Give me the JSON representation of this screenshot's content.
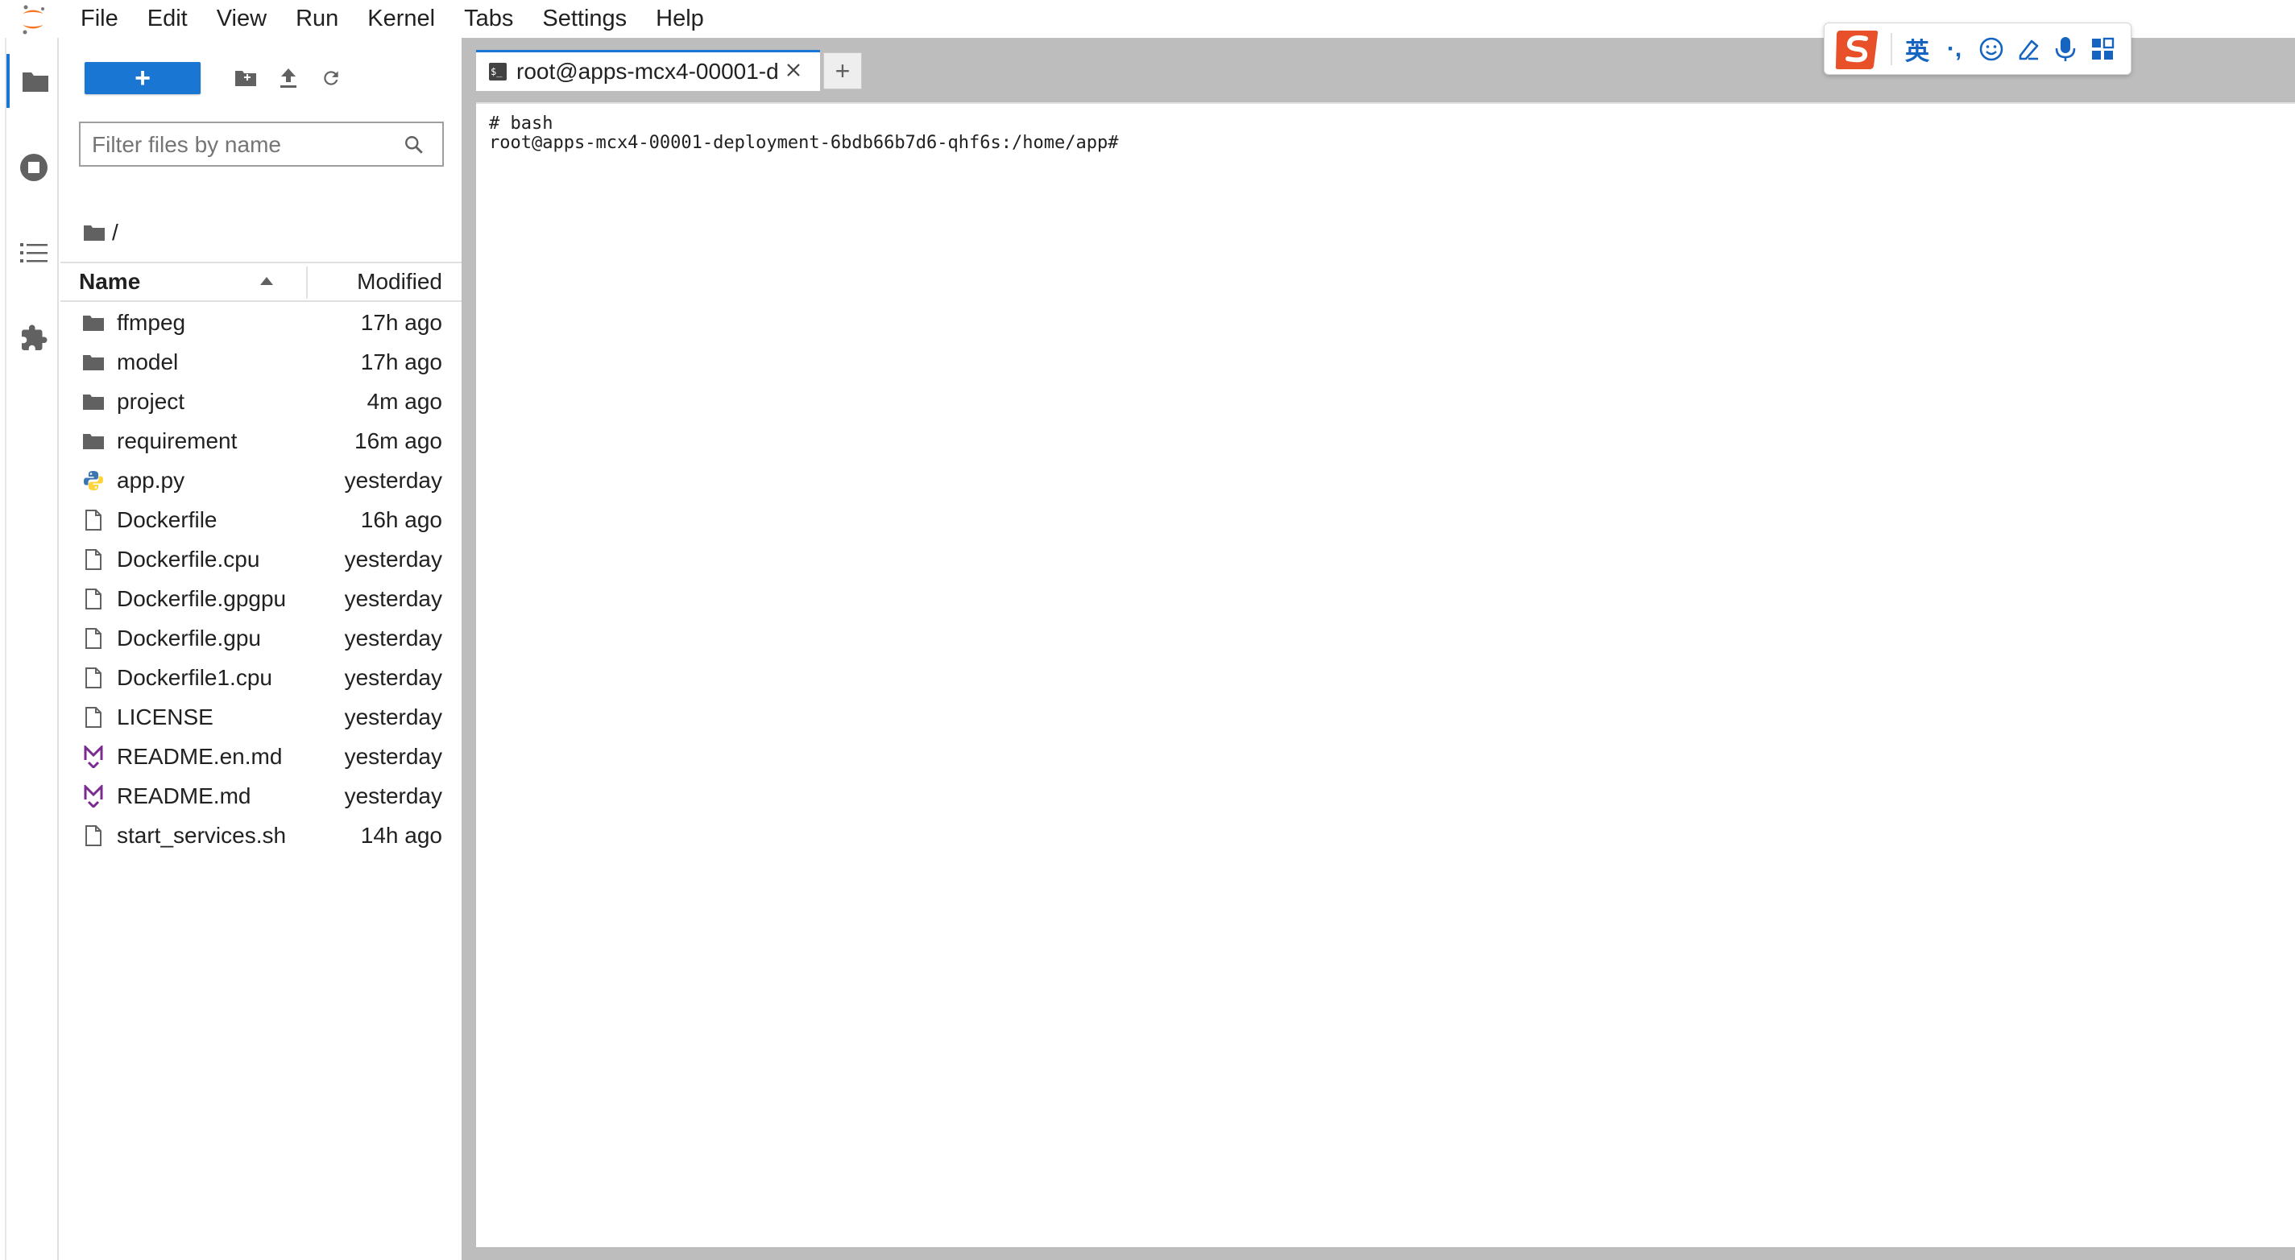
{
  "menubar": {
    "items": [
      "File",
      "Edit",
      "View",
      "Run",
      "Kernel",
      "Tabs",
      "Settings",
      "Help"
    ]
  },
  "leftbar": {
    "tabs": [
      "folder-icon",
      "running-icon",
      "toc-icon",
      "extension-icon"
    ]
  },
  "filebrowser": {
    "new_label": "+",
    "filter_placeholder": "Filter files by name",
    "breadcrumb": "/",
    "columns": {
      "name": "Name",
      "modified": "Modified"
    },
    "files": [
      {
        "name": "ffmpeg",
        "modified": "17h ago",
        "icon": "folder-icon"
      },
      {
        "name": "model",
        "modified": "17h ago",
        "icon": "folder-icon"
      },
      {
        "name": "project",
        "modified": "4m ago",
        "icon": "folder-icon"
      },
      {
        "name": "requirement",
        "modified": "16m ago",
        "icon": "folder-icon"
      },
      {
        "name": "app.py",
        "modified": "yesterday",
        "icon": "python-icon"
      },
      {
        "name": "Dockerfile",
        "modified": "16h ago",
        "icon": "file-icon"
      },
      {
        "name": "Dockerfile.cpu",
        "modified": "yesterday",
        "icon": "file-icon"
      },
      {
        "name": "Dockerfile.gpgpu",
        "modified": "yesterday",
        "icon": "file-icon"
      },
      {
        "name": "Dockerfile.gpu",
        "modified": "yesterday",
        "icon": "file-icon"
      },
      {
        "name": "Dockerfile1.cpu",
        "modified": "yesterday",
        "icon": "file-icon"
      },
      {
        "name": "LICENSE",
        "modified": "yesterday",
        "icon": "file-icon"
      },
      {
        "name": "README.en.md",
        "modified": "yesterday",
        "icon": "markdown-icon"
      },
      {
        "name": "README.md",
        "modified": "yesterday",
        "icon": "markdown-icon"
      },
      {
        "name": "start_services.sh",
        "modified": "14h ago",
        "icon": "file-icon"
      }
    ]
  },
  "tabs": {
    "terminal_tab": {
      "label": "root@apps-mcx4-00001-d",
      "icon_text": "$_"
    },
    "add_tab_label": "+"
  },
  "terminal": {
    "lines": [
      "# bash",
      "root@apps-mcx4-00001-deployment-6bdb66b7d6-qhf6s:/home/app#"
    ]
  },
  "ime": {
    "lang_label": "英",
    "punct_label": "·,"
  },
  "colors": {
    "accent": "#1976d2",
    "panel_gray": "#bdbdbd",
    "ime_logo": "#e8502a",
    "markdown_purple": "#7b2c8f"
  }
}
